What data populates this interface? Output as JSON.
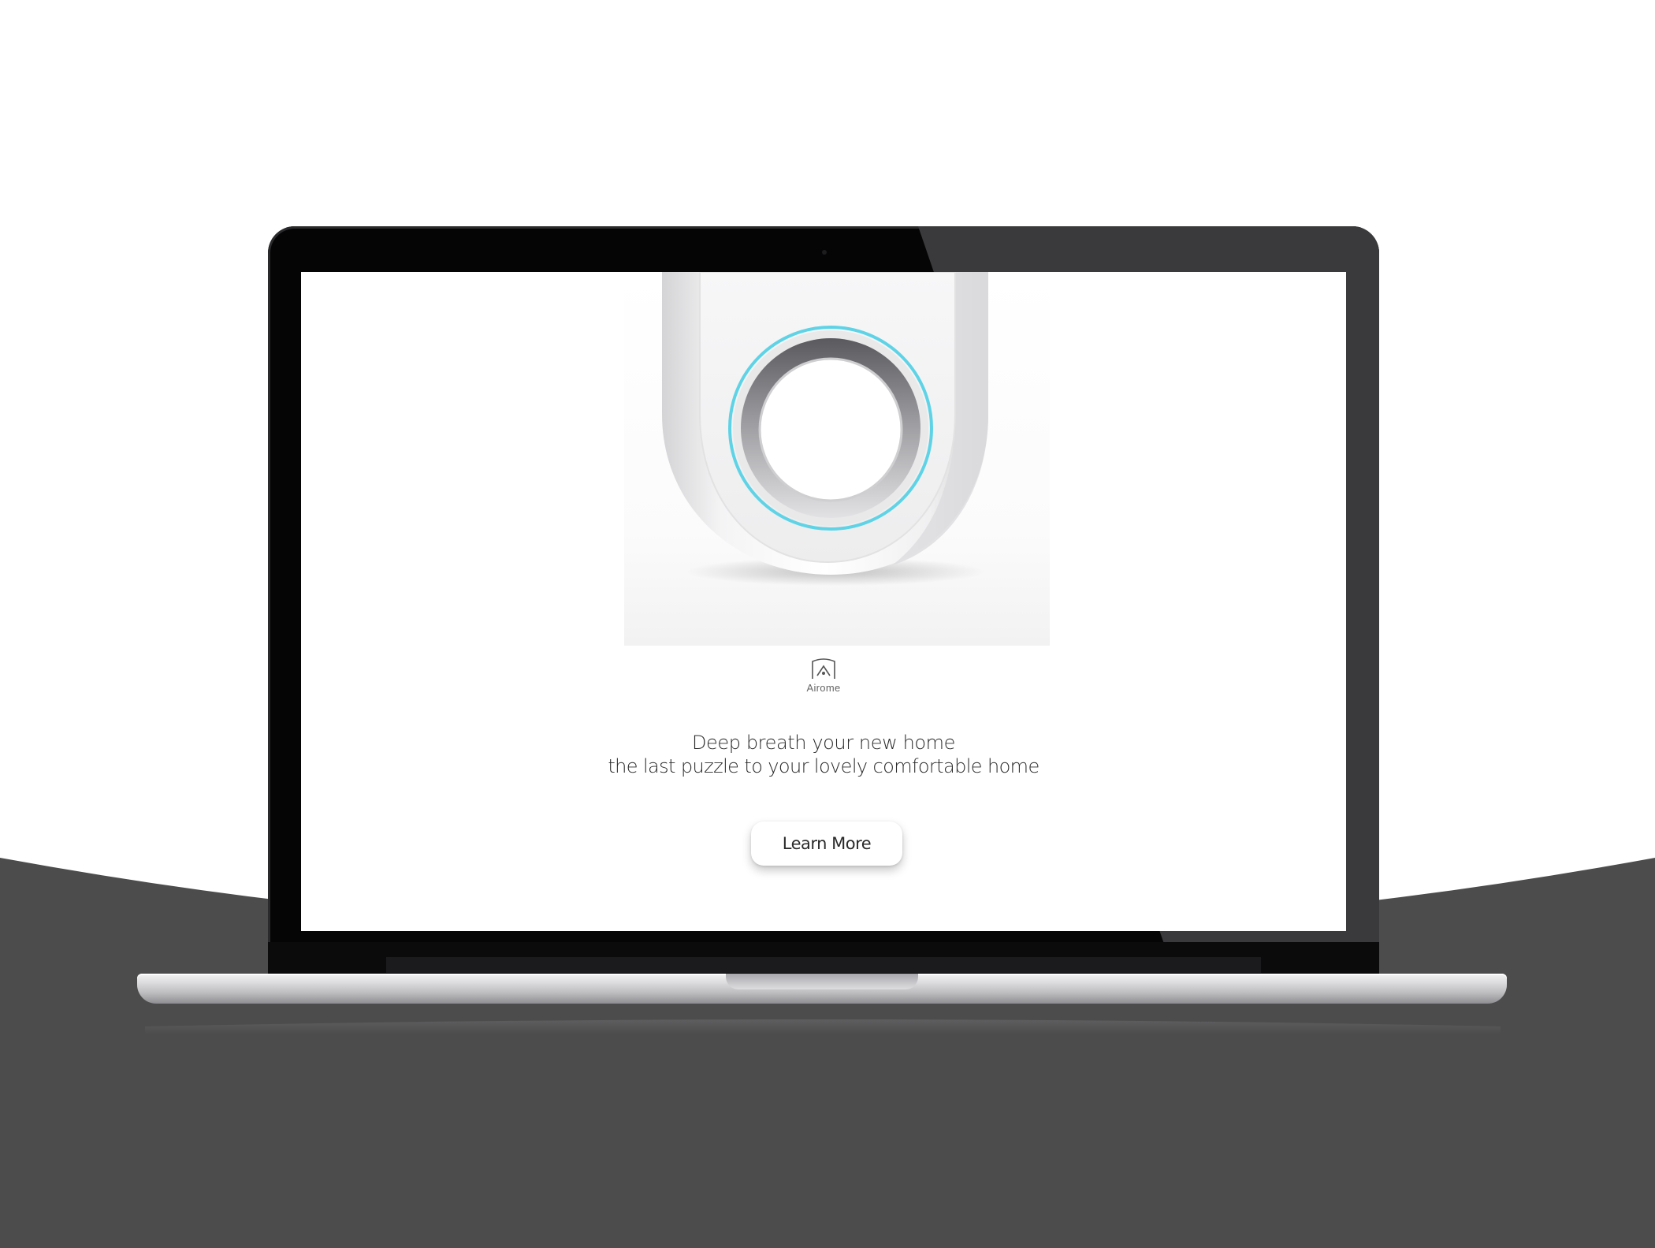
{
  "scene": {
    "background_light": "#ffffff",
    "background_dark": "#4c4c4c",
    "device": "laptop"
  },
  "website": {
    "brand": {
      "name": "Airome",
      "logo_icon": "house-outline-icon"
    },
    "hero": {
      "product_image": "air-purifier-ring-device",
      "ring_light_color": "#5fd3e6",
      "headline_line1": "Deep breath your new home",
      "headline_line2": "the last puzzle to your lovely comfortable home"
    },
    "cta": {
      "label": "Learn More"
    }
  }
}
